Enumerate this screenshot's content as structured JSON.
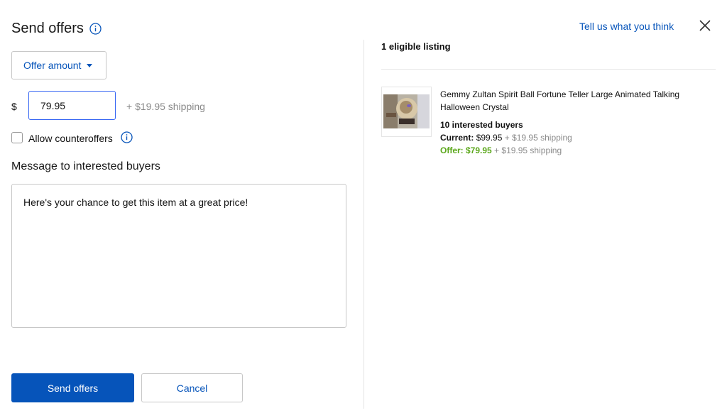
{
  "header": {
    "title": "Send offers",
    "feedback_link": "Tell us what you think"
  },
  "form": {
    "offer_type_label": "Offer amount",
    "currency_symbol": "$",
    "amount_value": "79.95",
    "shipping_note": "+ $19.95 shipping",
    "counteroffers_label": "Allow counteroffers",
    "counteroffers_checked": false,
    "message_heading": "Message to interested buyers",
    "message_value": "Here's your chance to get this item at a great price!"
  },
  "actions": {
    "send_label": "Send offers",
    "cancel_label": "Cancel"
  },
  "listings": {
    "heading": "1 eligible listing",
    "items": [
      {
        "title": "Gemmy Zultan Spirit Ball Fortune Teller Large Animated Talking Halloween Crystal",
        "interested": "10 interested buyers",
        "current_label": "Current:",
        "current_price": "$99.95",
        "current_shipping": "+ $19.95 shipping",
        "offer_label": "Offer: $79.95",
        "offer_shipping": "+ $19.95 shipping"
      }
    ]
  },
  "colors": {
    "link": "#0654ba",
    "primary_button": "#0654ba",
    "input_focus_border": "#3665f3",
    "offer_green": "#5ba71b",
    "muted_text": "#8a8a8a"
  },
  "icons": {
    "title_info": "info-icon",
    "counteroffer_info": "info-icon",
    "close": "close-icon",
    "dropdown": "caret-down-icon"
  }
}
